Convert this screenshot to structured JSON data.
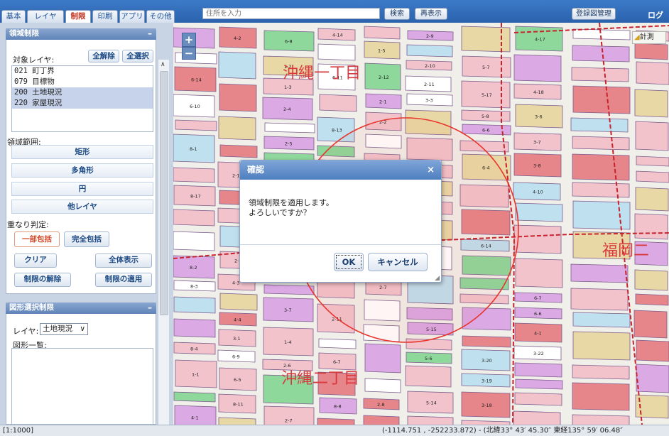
{
  "tabs": [
    "基本",
    "レイヤ",
    "制限",
    "印刷",
    "アプリ",
    "その他"
  ],
  "toolbar": {
    "address_placeholder": "住所を入力",
    "search": "検索",
    "redisplay": "再表示",
    "registered_map": "登録図管理",
    "login": "ログイ"
  },
  "region_panel": {
    "title": "領域制限",
    "target_layer_label": "対象レイヤ:",
    "clear_all": "全解除",
    "select_all": "全選択",
    "layers": [
      {
        "label": "021 町丁界",
        "selected": false
      },
      {
        "label": "079 目標物",
        "selected": false
      },
      {
        "label": "200 土地現況",
        "selected": true
      },
      {
        "label": "220 家屋現況",
        "selected": true
      }
    ],
    "range_label": "領域範囲:",
    "range_buttons": [
      "矩形",
      "多角形",
      "円",
      "他レイヤ"
    ],
    "overlap_label": "重なり判定:",
    "overlap_options": [
      "一部包括",
      "完全包括"
    ],
    "clear": "クリア",
    "show_all": "全体表示",
    "release": "制限の解除",
    "apply": "制限の適用"
  },
  "shape_panel": {
    "title": "図形選択制限",
    "layer_label": "レイヤ:",
    "layer_value": "土地現況",
    "list_label": "図形一覧:"
  },
  "map": {
    "area_labels": [
      "沖縄一丁目",
      "沖縄二丁目",
      "福岡二"
    ],
    "parcel_labels": [
      "6-14",
      "6-10",
      "8-1",
      "8-17",
      "8-2",
      "8-3",
      "8-4",
      "1-1",
      "4-1",
      "4-2",
      "2-16",
      "2-3",
      "4-3",
      "4-4",
      "3-1",
      "6-9",
      "6-5",
      "8-11",
      "6-8",
      "1-2",
      "1-3",
      "2-4",
      "2-5",
      "4-16",
      "4-13",
      "6-15",
      "6-12",
      "3-7",
      "1-4",
      "2-6",
      "2-7",
      "4-14",
      "6-11",
      "8-13",
      "8-15",
      "2-8",
      "2-9",
      "2-10",
      "2-11",
      "6-7",
      "8-8",
      "1-5",
      "2-12",
      "2-1",
      "2-2",
      "2-3",
      "2-4",
      "2-5",
      "2-6",
      "2-7",
      "2-8",
      "2-9",
      "2-10",
      "2-11",
      "3-3",
      "3-4",
      "4-12",
      "5-12",
      "5-4",
      "5-15",
      "5-6",
      "5-14",
      "5-11",
      "5-7",
      "5-17",
      "5-8",
      "6-6",
      "6-4",
      "6-14",
      "3-20",
      "3-19",
      "3-18",
      "3-17",
      "4-17",
      "4-18",
      "3-6",
      "3-7",
      "3-8",
      "4-10",
      "6-7",
      "6-6",
      "4-1",
      "3-22"
    ],
    "calc_label": "計測",
    "zoom_in": "+",
    "zoom_out": "−"
  },
  "dialog": {
    "title": "確認",
    "message_line1": "領域制限を適用します。",
    "message_line2": "よろしいですか？",
    "ok": "OK",
    "cancel": "キャンセル",
    "close": "×"
  },
  "status": {
    "scale": "[1:1000]",
    "coords": "(-1114.751 , -252233.872) - (北緯33° 43′ 45.30″ 東経135° 59′ 06.48″"
  },
  "colors": {
    "header": "#2b62ad",
    "panel_title": "#5f84b9",
    "parcel_red": "#e7868a",
    "parcel_pink": "#f3c3cc",
    "parcel_purple": "#dba9e3",
    "parcel_green": "#8fd89c",
    "parcel_blue": "#bfe0ee",
    "district_line": "#c8232c",
    "circle": "#e8342c"
  }
}
